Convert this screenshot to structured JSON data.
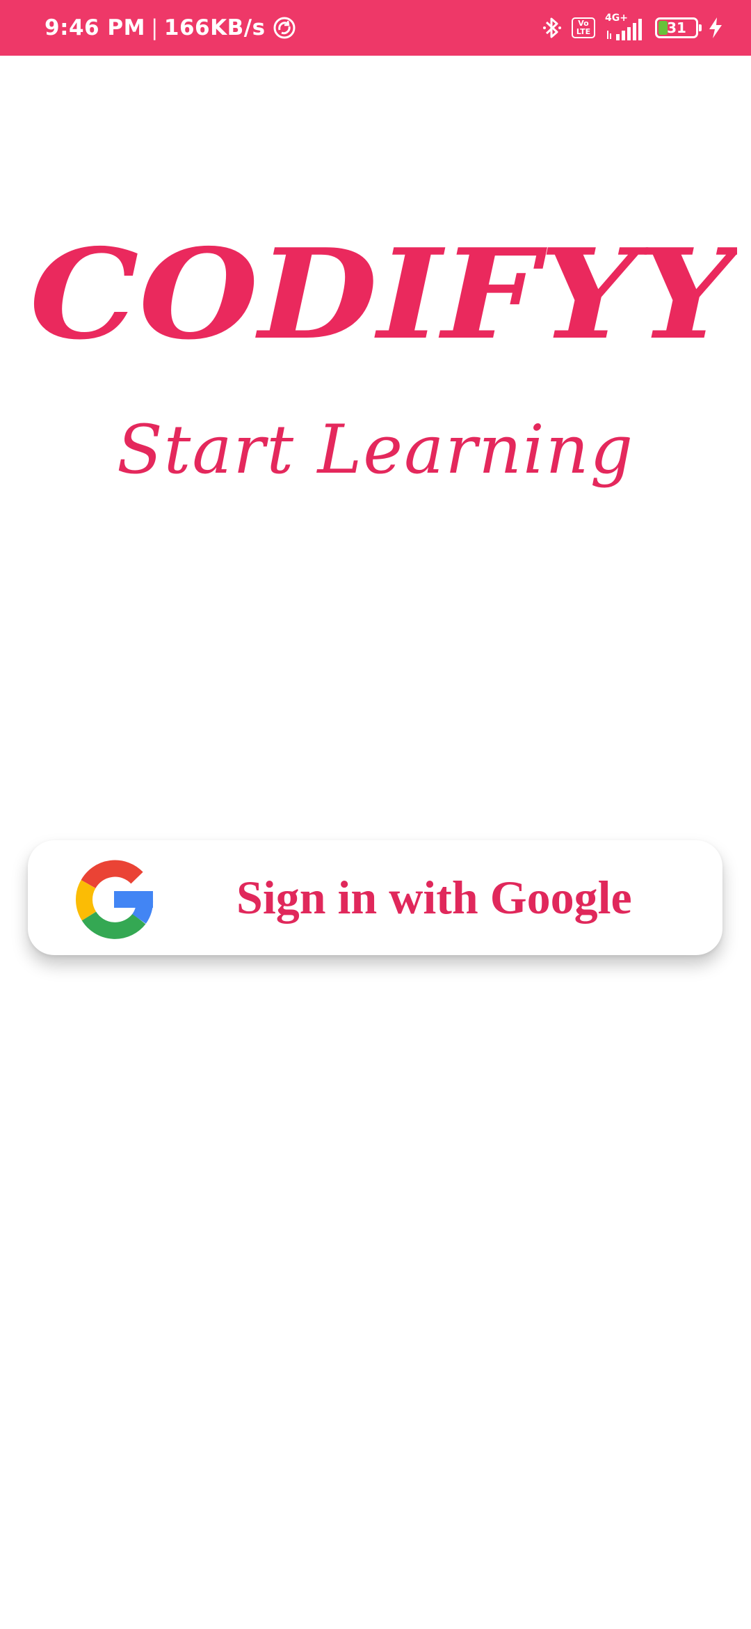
{
  "status_bar": {
    "time": "9:46 PM",
    "separator": "|",
    "network_speed": "166KB/s",
    "network_type": "4G+",
    "volte_top": "Vo",
    "volte_bottom": "LTE",
    "battery_level": "31",
    "battery_fraction": 0.31,
    "icons": [
      "sync-icon",
      "bluetooth-icon",
      "volte-icon",
      "signal-icon",
      "battery-icon",
      "charging-icon"
    ],
    "background_color": "#ee3868"
  },
  "logo": {
    "text": "CODIFYY",
    "color": "#ea295d"
  },
  "tagline": "Start Learning",
  "google_button": {
    "label": "Sign in with Google",
    "icon": "google-logo-icon"
  }
}
